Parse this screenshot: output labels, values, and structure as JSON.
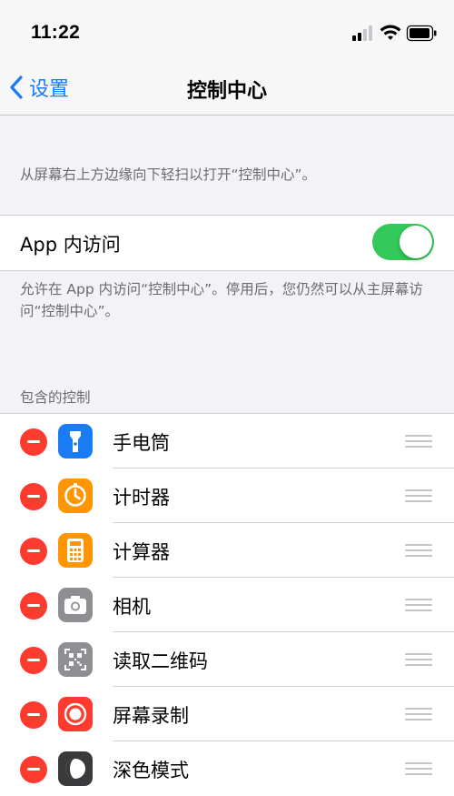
{
  "status_bar": {
    "time": "11:22"
  },
  "nav": {
    "back_label": "设置",
    "title": "控制中心"
  },
  "intro_text": "从屏幕右上方边缘向下轻扫以打开“控制中心”。",
  "app_access": {
    "label": "App 内访问",
    "enabled": true,
    "footer": "允许在 App 内访问“控制中心”。停用后，您仍然可以从主屏幕访问“控制中心”。"
  },
  "included_controls": {
    "header": "包含的控制",
    "items": [
      {
        "label": "手电筒",
        "icon": "flashlight-icon",
        "color": "#1a7cf5"
      },
      {
        "label": "计时器",
        "icon": "timer-icon",
        "color": "#ff9500"
      },
      {
        "label": "计算器",
        "icon": "calculator-icon",
        "color": "#ff9500"
      },
      {
        "label": "相机",
        "icon": "camera-icon",
        "color": "#8e8e93"
      },
      {
        "label": "读取二维码",
        "icon": "qr-code-icon",
        "color": "#8e8e93"
      },
      {
        "label": "屏幕录制",
        "icon": "screen-recording-icon",
        "color": "#ff3b30"
      },
      {
        "label": "深色模式",
        "icon": "dark-mode-icon",
        "color": "#3a3a3c"
      }
    ]
  },
  "colors": {
    "accent": "#1a7cf5",
    "toggle_on": "#34c759",
    "remove": "#ff3b30",
    "background": "#f2f2f7"
  }
}
